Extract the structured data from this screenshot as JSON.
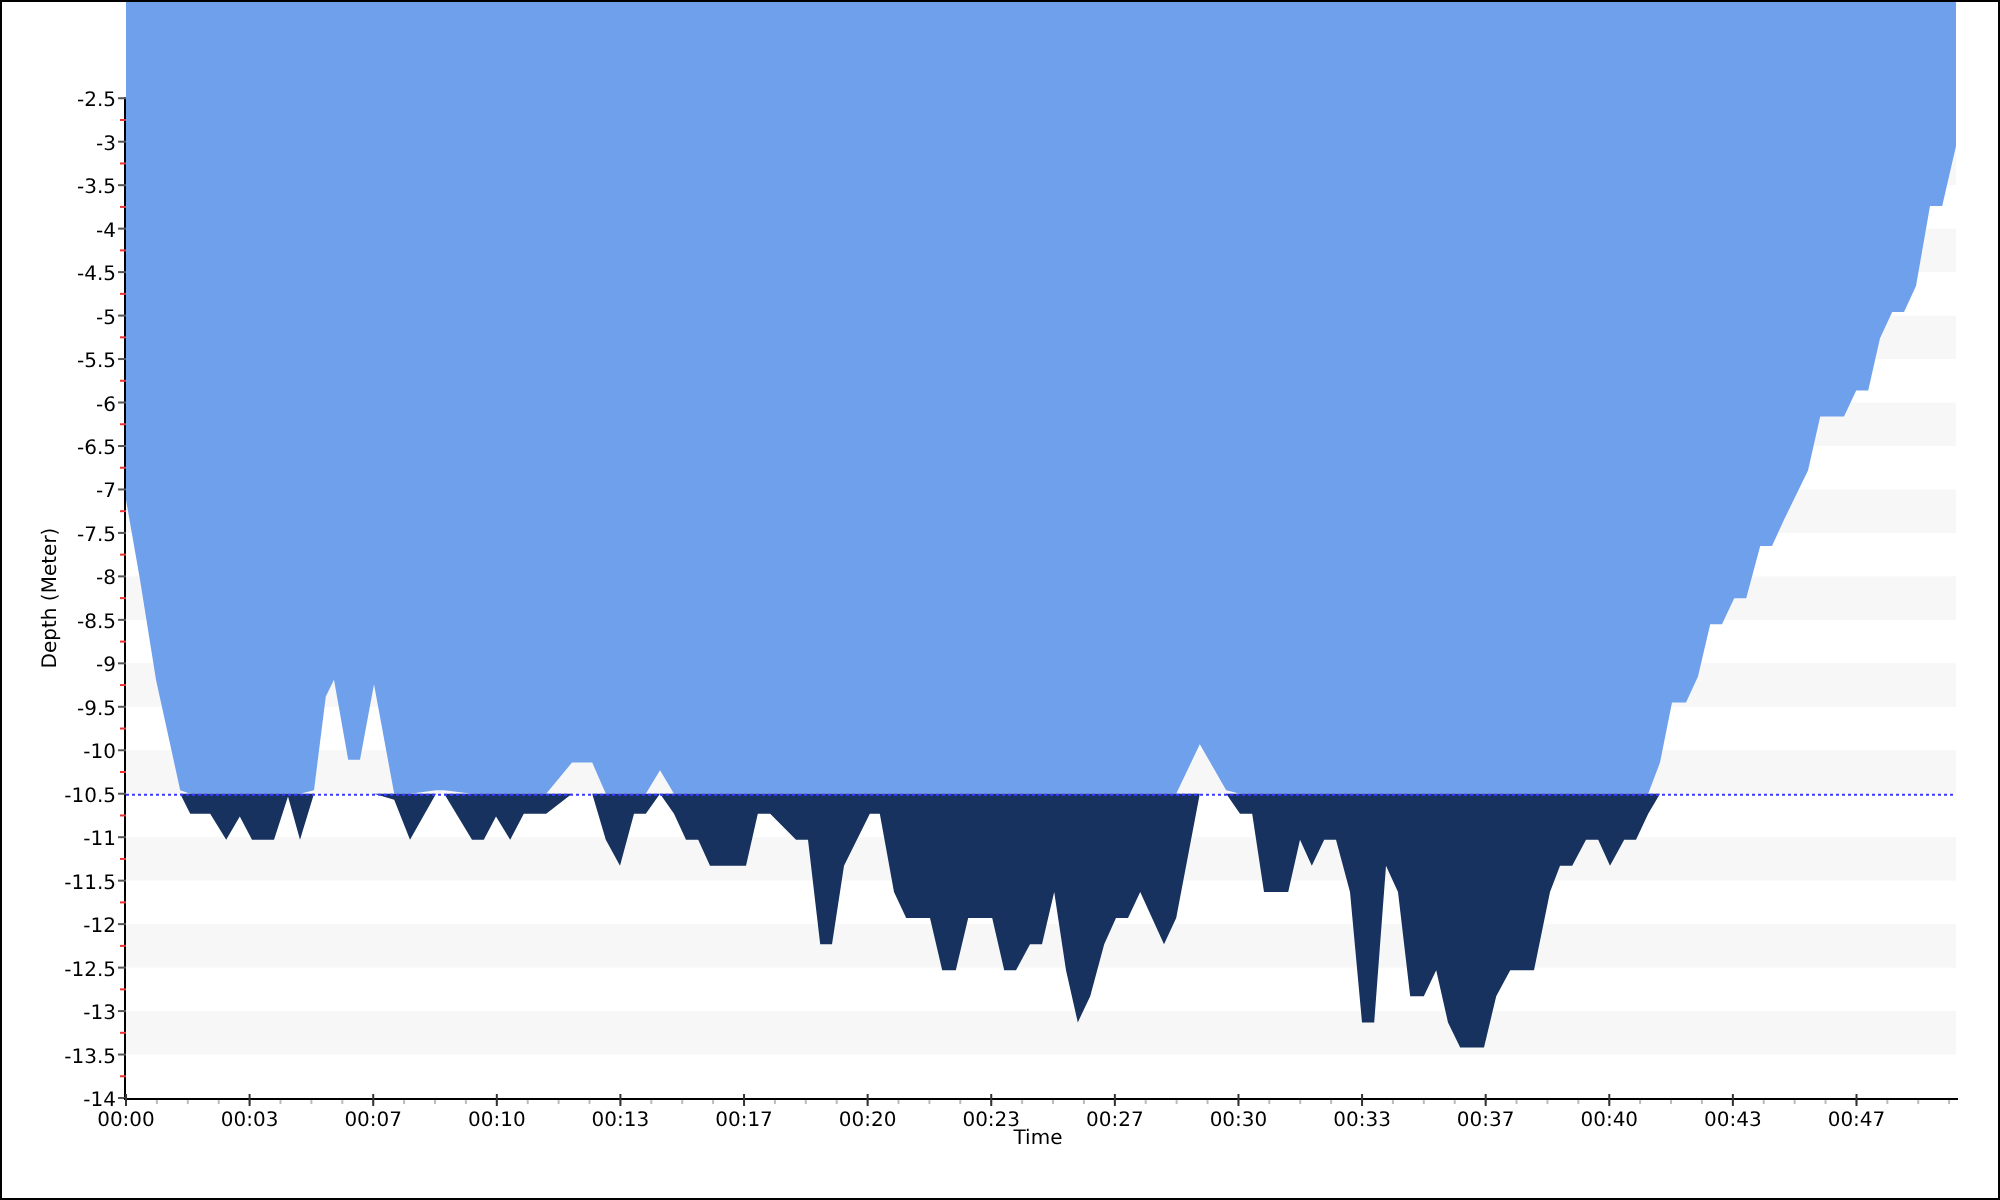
{
  "chart": {
    "chart_data": {
      "type": "area",
      "xlabel": "Time",
      "ylabel": "Depth (Meter)",
      "x": [
        0,
        0.38,
        0.81,
        1.46,
        1.73,
        2.27,
        2.7,
        3.07,
        3.4,
        3.99,
        4.37,
        4.69,
        5.07,
        5.39,
        5.61,
        5.99,
        6.31,
        6.69,
        7.23,
        7.66,
        8.36,
        8.58,
        9.33,
        9.65,
        9.98,
        10.36,
        10.73,
        11.33,
        12.03,
        12.57,
        12.94,
        13.32,
        13.7,
        14.02,
        14.4,
        14.78,
        15.1,
        15.43,
        15.75,
        16.72,
        17.04,
        17.37,
        18.07,
        18.39,
        18.72,
        19.04,
        19.36,
        20.06,
        20.33,
        20.71,
        21.04,
        21.68,
        22.01,
        22.38,
        22.71,
        23.36,
        23.68,
        24.0,
        24.38,
        24.7,
        25.03,
        25.35,
        25.67,
        26.0,
        26.38,
        26.7,
        27.02,
        27.35,
        27.99,
        28.32,
        28.96,
        29.67,
        30.04,
        30.37,
        30.69,
        31.34,
        31.66,
        31.98,
        32.31,
        32.63,
        33.01,
        33.33,
        33.66,
        33.98,
        34.3,
        34.63,
        35.0,
        35.33,
        35.65,
        35.98,
        36.62,
        36.95,
        37.33,
        37.97,
        38.4,
        38.67,
        39.0,
        39.37,
        39.7,
        40.02,
        40.4,
        40.72,
        41.05,
        41.37,
        41.69,
        42.07,
        42.39,
        42.72,
        43.04,
        43.37,
        43.69,
        44.07,
        44.39,
        44.71,
        45.36,
        45.69,
        46.33,
        46.66,
        46.98,
        47.3,
        47.63,
        47.95,
        48.27,
        48.65,
        48.98,
        49.35
      ],
      "series": [
        {
          "color": "#6fa0ec",
          "values": [
            -7.12,
            -8.04,
            -9.19,
            -10.46,
            -10.5,
            -10.5,
            -10.5,
            -10.5,
            -10.5,
            -10.5,
            -10.5,
            -10.5,
            -10.46,
            -9.38,
            -9.19,
            -10.11,
            -10.11,
            -9.24,
            -10.5,
            -10.5,
            -10.46,
            -10.46,
            -10.5,
            -10.5,
            -10.5,
            -10.5,
            -10.5,
            -10.5,
            -10.14,
            -10.14,
            -10.5,
            -10.5,
            -10.5,
            -10.5,
            -10.23,
            -10.5,
            -10.5,
            -10.5,
            -10.5,
            -10.5,
            -10.5,
            -10.5,
            -10.5,
            -10.5,
            -10.5,
            -10.5,
            -10.5,
            -10.5,
            -10.5,
            -10.5,
            -10.5,
            -10.5,
            -10.5,
            -10.5,
            -10.5,
            -10.5,
            -10.5,
            -10.5,
            -10.5,
            -10.5,
            -10.5,
            -10.5,
            -10.5,
            -10.5,
            -10.5,
            -10.5,
            -10.5,
            -10.5,
            -10.5,
            -10.5,
            -9.93,
            -10.46,
            -10.5,
            -10.5,
            -10.5,
            -10.5,
            -10.5,
            -10.5,
            -10.5,
            -10.5,
            -10.5,
            -10.5,
            -10.5,
            -10.5,
            -10.5,
            -10.5,
            -10.5,
            -10.5,
            -10.5,
            -10.5,
            -10.5,
            -10.5,
            -10.5,
            -10.5,
            -10.5,
            -10.5,
            -10.5,
            -10.5,
            -10.5,
            -10.5,
            -10.5,
            -10.5,
            -10.5,
            -10.14,
            -9.45,
            -9.45,
            -9.15,
            -8.55,
            -8.55,
            -8.25,
            -8.25,
            -7.65,
            -7.65,
            -7.35,
            -6.78,
            -6.16,
            -6.16,
            -5.86,
            -5.86,
            -5.26,
            -4.96,
            -4.96,
            -4.66,
            -3.74,
            -3.74,
            -3.05
          ]
        },
        {
          "color": "#17325f",
          "values": [
            null,
            null,
            null,
            -10.5,
            -10.73,
            -10.73,
            -11.03,
            -10.76,
            -11.03,
            -11.03,
            -10.53,
            -11.03,
            -10.5,
            null,
            null,
            null,
            null,
            -10.5,
            -10.57,
            -11.03,
            -10.5,
            -10.5,
            -11.03,
            -11.03,
            -10.76,
            -11.03,
            -10.73,
            -10.73,
            -10.5,
            -10.5,
            -11.03,
            -11.33,
            -10.73,
            -10.73,
            -10.5,
            -10.73,
            -11.03,
            -11.03,
            -11.33,
            -11.33,
            -10.73,
            -10.73,
            -11.03,
            -11.03,
            -12.23,
            -12.23,
            -11.33,
            -10.73,
            -10.73,
            -11.63,
            -11.93,
            -11.93,
            -12.53,
            -12.53,
            -11.93,
            -11.93,
            -12.53,
            -12.53,
            -12.23,
            -12.23,
            -11.63,
            -12.53,
            -13.13,
            -12.83,
            -12.23,
            -11.93,
            -11.93,
            -11.63,
            -12.23,
            -11.93,
            -10.5,
            -10.5,
            -10.73,
            -10.73,
            -11.63,
            -11.63,
            -11.03,
            -11.33,
            -11.03,
            -11.03,
            -11.63,
            -13.13,
            -13.13,
            -11.33,
            -11.63,
            -12.83,
            -12.83,
            -12.53,
            -13.13,
            -13.42,
            -13.42,
            -12.83,
            -12.53,
            -12.53,
            -11.63,
            -11.33,
            -11.33,
            -11.03,
            -11.03,
            -11.33,
            -11.03,
            -11.03,
            -10.73,
            -10.5,
            null,
            null,
            null,
            null,
            null,
            null,
            null,
            null,
            null,
            null,
            null,
            null,
            null,
            null,
            null,
            null,
            null,
            null,
            null,
            null,
            null,
            null
          ]
        }
      ],
      "xlim": [
        0,
        49.35
      ],
      "ylim": [
        -14,
        -1.37
      ],
      "xticks": [
        {
          "value": 0,
          "label": "00:00"
        },
        {
          "value": 3.333,
          "label": "00:03"
        },
        {
          "value": 6.667,
          "label": "00:07"
        },
        {
          "value": 10,
          "label": "00:10"
        },
        {
          "value": 13.333,
          "label": "00:13"
        },
        {
          "value": 16.667,
          "label": "00:17"
        },
        {
          "value": 20,
          "label": "00:20"
        },
        {
          "value": 23.333,
          "label": "00:23"
        },
        {
          "value": 26.667,
          "label": "00:27"
        },
        {
          "value": 30,
          "label": "00:30"
        },
        {
          "value": 33.333,
          "label": "00:33"
        },
        {
          "value": 36.667,
          "label": "00:37"
        },
        {
          "value": 40,
          "label": "00:40"
        },
        {
          "value": 43.333,
          "label": "00:43"
        },
        {
          "value": 46.667,
          "label": "00:47"
        }
      ],
      "yticks": [
        -2.5,
        -3,
        -3.5,
        -4,
        -4.5,
        -5,
        -5.5,
        -6,
        -6.5,
        -7,
        -7.5,
        -8,
        -8.5,
        -9,
        -9.5,
        -10,
        -10.5,
        -11,
        -11.5,
        -12,
        -12.5,
        -13,
        -13.5,
        -14
      ],
      "ref_lines": [
        {
          "axis": "y",
          "value": -10.5
        }
      ]
    }
  }
}
